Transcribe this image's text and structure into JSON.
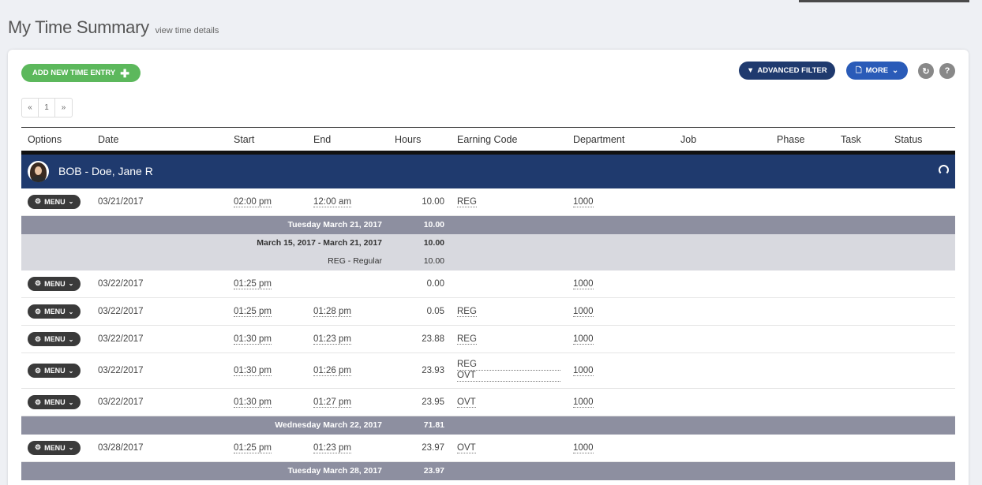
{
  "page": {
    "title": "My Time Summary",
    "subtitle_link": "view time details"
  },
  "toolbar": {
    "add_label": "ADD NEW TIME ENTRY",
    "filter_label": "ADVANCED FILTER",
    "more_label": "MORE"
  },
  "pager": {
    "prev": "«",
    "page": "1",
    "next": "»"
  },
  "columns": [
    "Options",
    "Date",
    "Start",
    "End",
    "Hours",
    "Earning Code",
    "Department",
    "Job",
    "Phase",
    "Task",
    "Status"
  ],
  "group": {
    "name": "BOB - Doe, Jane R"
  },
  "menu_label": "MENU",
  "rows": [
    {
      "date": "03/21/2017",
      "start": "02:00 pm",
      "end": "12:00 am",
      "hours": "10.00",
      "code": "REG",
      "dept": "1000"
    },
    {
      "date": "03/22/2017",
      "start": "01:25 pm",
      "end": "",
      "hours": "0.00",
      "code": "",
      "dept": "1000"
    },
    {
      "date": "03/22/2017",
      "start": "01:25 pm",
      "end": "01:28 pm",
      "hours": "0.05",
      "code": "REG",
      "dept": "1000"
    },
    {
      "date": "03/22/2017",
      "start": "01:30 pm",
      "end": "01:23 pm",
      "hours": "23.88",
      "code": "REG",
      "dept": "1000"
    },
    {
      "date": "03/22/2017",
      "start": "01:30 pm",
      "end": "01:26 pm",
      "hours": "23.93",
      "code": "REG",
      "code2": "OVT",
      "dept": "1000"
    },
    {
      "date": "03/22/2017",
      "start": "01:30 pm",
      "end": "01:27 pm",
      "hours": "23.95",
      "code": "OVT",
      "dept": "1000"
    },
    {
      "date": "03/28/2017",
      "start": "01:25 pm",
      "end": "01:23 pm",
      "hours": "23.97",
      "code": "OVT",
      "dept": "1000"
    }
  ],
  "totals": {
    "day1": {
      "label": "Tuesday March 21, 2017",
      "hours": "10.00"
    },
    "period": {
      "label": "March 15, 2017  -  March 21, 2017",
      "hours": "10.00",
      "sub_label": "REG - Regular",
      "sub_hours": "10.00"
    },
    "day2": {
      "label": "Wednesday March 22, 2017",
      "hours": "71.81"
    },
    "day3": {
      "label": "Tuesday March 28, 2017",
      "hours": "23.97"
    }
  }
}
